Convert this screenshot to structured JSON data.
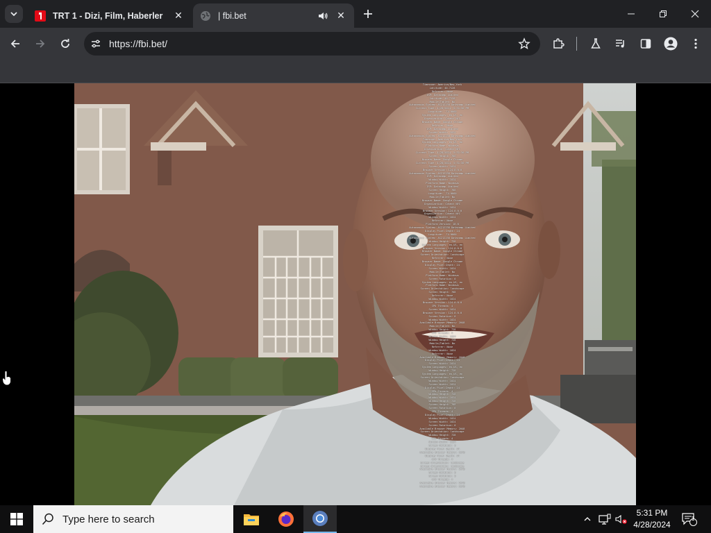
{
  "browser": {
    "tabs": [
      {
        "title": "TRT 1 - Dizi, Film, Haberler",
        "state": "inactive",
        "favicon": "trt1-logo-icon"
      },
      {
        "title": "| fbi.bet",
        "state": "active",
        "favicon": "globe-icon",
        "audio": "speaker-icon"
      }
    ],
    "url": "https://fbi.bet/",
    "colors": {
      "tabstrip": "#202124",
      "toolbar": "#35363a",
      "omnibox": "#202124",
      "text": "#e8eaed",
      "trt_red": "#e30a17"
    }
  },
  "page": {
    "fingerprint_lines": [
      "Timezone: America/New_York",
      "Latitude: 40.7128",
      "Referrer: None",
      "ISP: Datacamp Limited",
      "Latitude: 40.7128",
      "Mobile/Tablet: No",
      "Autonomous System: AS212238 Datacamp Limited",
      "Current Time: 4/28/2024, 5:31:30 PM",
      "Longitude: -74.0060",
      "System Languages: en-US, en",
      "Organization: Cdnext NYC",
      "Browser Name: Google Chrome",
      "Referrer: None",
      "ISP: Datacamp Limited",
      "Screen Width: 1024",
      "Autonomous System: AS212238 Datacamp Limited",
      "Timezone: America/New_York",
      "System Languages: en-US, en",
      "Platform Name: Windows",
      "Organization: Cdnext NYC",
      "Current Time: 4/28/2024, 5:31:30 PM",
      "Screen Height: 768",
      "Browser Name: Google Chrome",
      "Current Time: 4/28/2024, 5:31:30 PM",
      "Screen Width: 1024",
      "Browser Version: 124.0.0.0",
      "Autonomous System: AS212238 Datacamp Limited",
      "ISP: Datacamp Limited",
      "Window Width: 1024",
      "Platform Name: Windows",
      "ISP: Datacamp Limited",
      "Screen Height: 768",
      "Longitude: -74.0060",
      "Mobile/Tablet: No",
      "Browser Name: Google Chrome",
      "Organization: Cdnext NYC",
      "Window Width: 1024",
      "Browser Version: 124.0.0.0",
      "Organization: Cdnext NYC",
      "Window Width: 1024",
      "Referrer: None",
      "Platform Version: 10.0",
      "Autonomous System: AS212238 Datacamp Limited",
      "Display Pixel Depth: 24",
      "Longitude: -74.0060",
      "Autonomous System: AS212238 Datacamp Limited",
      "Window Height: 728",
      "System Languages: en-US, en",
      "Browser Version: 124.0.0.0",
      "Browser Name: Google Chrome",
      "Screen Orientation: landscape",
      "Referrer: None",
      "Browser Name: Google Chrome",
      "Display Pixel Depth: 24",
      "Screen Width: 1024",
      "Mobile/Tablet: No",
      "Platform Name: Windows",
      "Screen Rotation: 0",
      "System Languages: en-US, en",
      "Platform Name: Windows",
      "Screen Orientation: landscape",
      "Screen Height: 768",
      "Referrer: None",
      "Window Width: 1024",
      "Browser Version: 124.0.0.0",
      "CPU Threads: 4",
      "Screen Width: 1024",
      "Browser Version: 124.0.0.0",
      "Screen Rotation: 0",
      "Window Width: 1024",
      "Available Browser Memory: 2048",
      "Mobile/Tablet: No",
      "Window Height: 728",
      "CPU Threads: 4",
      "Window Width: 1024",
      "Window Height: 728",
      "Mobile/Tablet: No",
      "Referrer: None",
      "Window Width: 1024",
      "Referrer: None",
      "Available Browser Memory: 2048",
      "Display Pixel Depth: 24",
      "Screen Width: 1024",
      "System Languages: en-US, en",
      "Window Height: 728",
      "System Languages: en-US, en",
      "Screen Orientation: landscape",
      "Window Width: 1024",
      "Screen Width: 1024",
      "Display Pixel Depth: 24",
      "CPU Threads: 4",
      "Window Height: 728",
      "Window Width: 1024",
      "Window Height: 728",
      "Screen Height: 768",
      "Screen Rotation: 0",
      "CPU Threads: 4",
      "Display Pixel Depth: 24",
      "Window Width: 1024",
      "Screen Width: 1024",
      "Screen Rotation: 0",
      "Available Browser Memory: 2048",
      "Screen Orientation: landscape",
      "Window Height: 728",
      "CPU Threads: 4",
      "Window Width: 1024",
      "Screen Rotation: 0",
      "Display Pixel Depth: 24",
      "Available Browser Memory: 2048",
      "Display Pixel Depth: 24",
      "CPU Threads: 4",
      "Screen Orientation: landscape",
      "Screen Orientation: landscape",
      "Available Browser Memory: 2048",
      "Screen Rotation: 0",
      "Screen Rotation: 0",
      "CPU Threads: 4",
      "Available Browser Memory: 2048",
      "Available Browser Memory: 2048"
    ]
  },
  "taskbar": {
    "search_placeholder": "Type here to search",
    "apps": [
      {
        "name": "file-explorer-icon",
        "active": false
      },
      {
        "name": "firefox-icon",
        "active": false
      },
      {
        "name": "chrome-icon",
        "active": true
      }
    ],
    "clock": {
      "time": "5:31 PM",
      "date": "4/28/2024"
    },
    "notification_count": "1"
  }
}
